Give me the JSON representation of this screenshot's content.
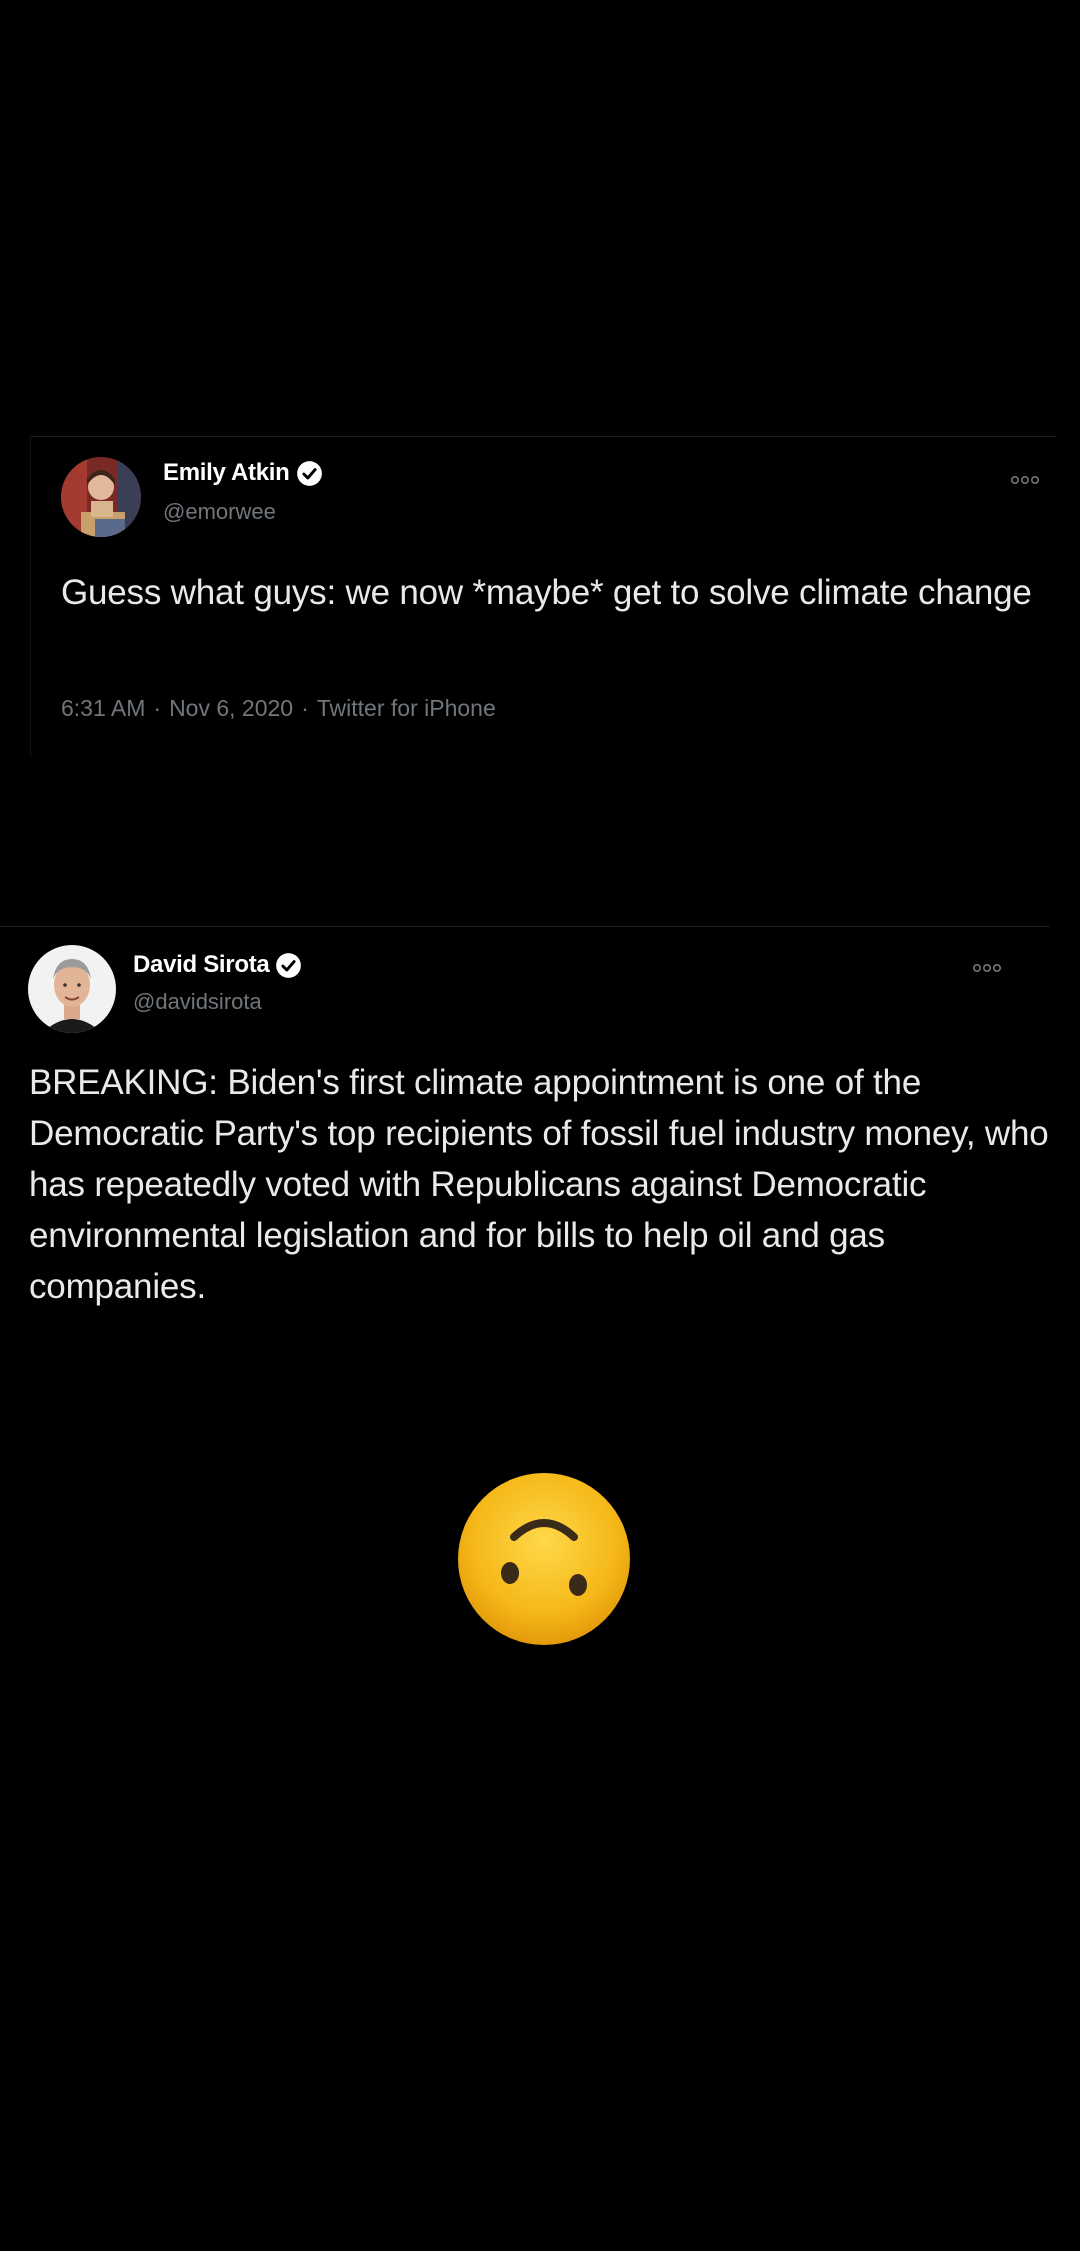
{
  "tweets": [
    {
      "display_name": "Emily Atkin",
      "handle": "@emorwee",
      "text": "Guess what guys: we now *maybe* get to solve climate change",
      "time": "6:31 AM",
      "date": "Nov 6, 2020",
      "source": "Twitter for iPhone",
      "verified_icon": "verified-badge-icon",
      "more_icon": "more-options-icon"
    },
    {
      "display_name": "David Sirota",
      "handle": "@davidsirota",
      "text": "BREAKING: Biden's first climate appointment is one of the Democratic Party's top recipients of fossil fuel industry money, who has repeatedly voted with Republicans against Democratic environmental legislation and for bills to help oil and gas companies.",
      "verified_icon": "verified-badge-icon",
      "more_icon": "more-options-icon"
    }
  ],
  "emoji": {
    "name": "upside-down-face-icon",
    "color": "#f5b818"
  },
  "colors": {
    "background": "#000000",
    "text": "#e7e9ea",
    "secondary_text": "#71767b"
  }
}
